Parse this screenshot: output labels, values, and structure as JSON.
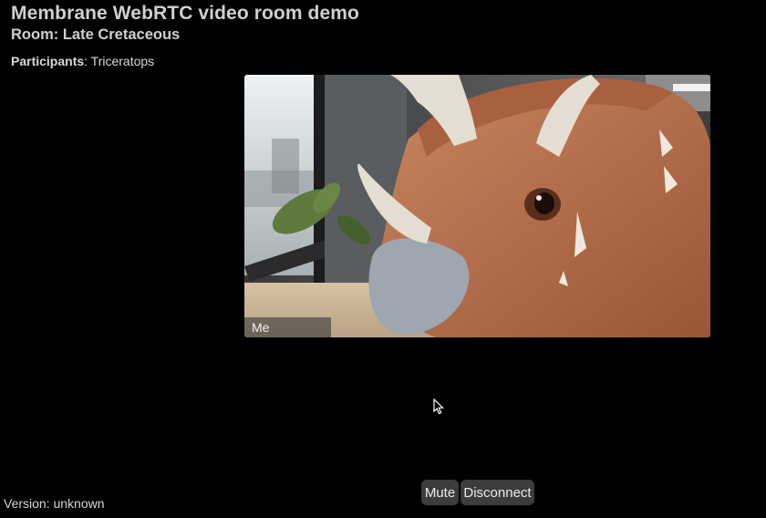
{
  "page": {
    "title": "Membrane WebRTC video room demo",
    "room_label": "Room: Late Cretaceous"
  },
  "participants": {
    "label": "Participants",
    "separator": ": ",
    "names": "Triceratops"
  },
  "video": {
    "name_overlay": "Me",
    "subject": "triceratops plush in front of office window"
  },
  "controls": {
    "mute_label": "Mute",
    "disconnect_label": "Disconnect"
  },
  "footer": {
    "version_text": "Version: unknown"
  },
  "colors": {
    "background": "#000000",
    "button_bg": "#3c3c3c",
    "plush_body": "#b86f4e",
    "horn": "#e4ded2"
  },
  "icons": {
    "cursor": "mouse-pointer-icon"
  }
}
